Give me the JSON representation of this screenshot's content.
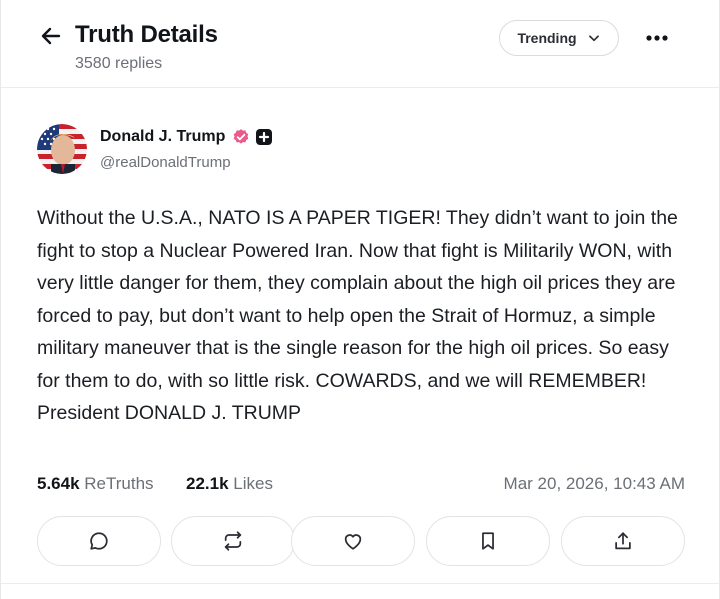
{
  "header": {
    "title": "Truth Details",
    "reply_count": "3580 replies",
    "sort_label": "Trending"
  },
  "post": {
    "author_name": "Donald J. Trump",
    "handle": "@realDonaldTrump",
    "body": "Without the U.S.A., NATO IS A PAPER TIGER! They didn’t want to join the fight to stop a Nuclear Powered Iran. Now that fight is Militarily WON, with very little danger for them, they complain about the high oil prices they are forced to pay, but don’t want to help open the Strait of Hormuz, a simple military maneuver that is the single reason for the high oil prices. So easy for them to do, with so little risk. COWARDS, and we will REMEMBER! President DONALD J. TRUMP",
    "retruths_count": "5.64k",
    "retruths_label": "ReTruths",
    "likes_count": "22.1k",
    "likes_label": "Likes",
    "timestamp": "Mar 20, 2026, 10:43 AM"
  },
  "actions": {
    "icons": [
      "reply-icon",
      "retruth-icon",
      "like-icon",
      "bookmark-icon",
      "share-icon"
    ]
  },
  "colors": {
    "verified": "#e95c8a",
    "text_primary": "#111418",
    "text_secondary": "#6b6f76",
    "border": "#e1e3e6"
  }
}
